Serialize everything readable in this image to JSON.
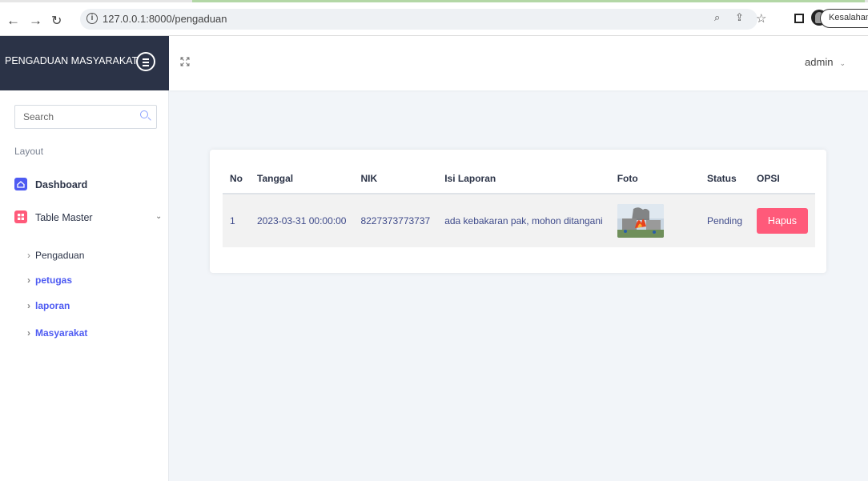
{
  "browser": {
    "url": "127.0.0.1:8000/pengaduan",
    "profile_button": "Kesalahan"
  },
  "sidebar": {
    "brand": "PENGADUAN MASYARAKAT",
    "search_placeholder": "Search",
    "section": "Layout",
    "items": [
      {
        "label": "Dashboard",
        "icon": "home-icon",
        "color": "#4e5bf2"
      },
      {
        "label": "Table Master",
        "icon": "grid-icon",
        "color": "#ff5a7a"
      }
    ],
    "subitems": [
      {
        "label": "Pengaduan",
        "color": "#2b3347"
      },
      {
        "label": "petugas",
        "color": "#4e5bf2"
      },
      {
        "label": "laporan",
        "color": "#4e5bf2"
      },
      {
        "label": "Masyarakat",
        "color": "#4e5bf2"
      }
    ]
  },
  "topbar": {
    "user": "admin"
  },
  "table": {
    "headers": [
      "No",
      "Tanggal",
      "NIK",
      "Isi Laporan",
      "Foto",
      "Status",
      "OPSI"
    ],
    "rows": [
      {
        "no": "1",
        "tanggal": "2023-03-31 00:00:00",
        "nik": "8227373773737",
        "isi": "ada kebakaran pak, mohon ditangani",
        "status": "Pending",
        "action": "Hapus"
      }
    ]
  },
  "colors": {
    "accent": "#4e5bf2",
    "danger": "#ff5a7a",
    "brand_bg": "#2b3347"
  }
}
